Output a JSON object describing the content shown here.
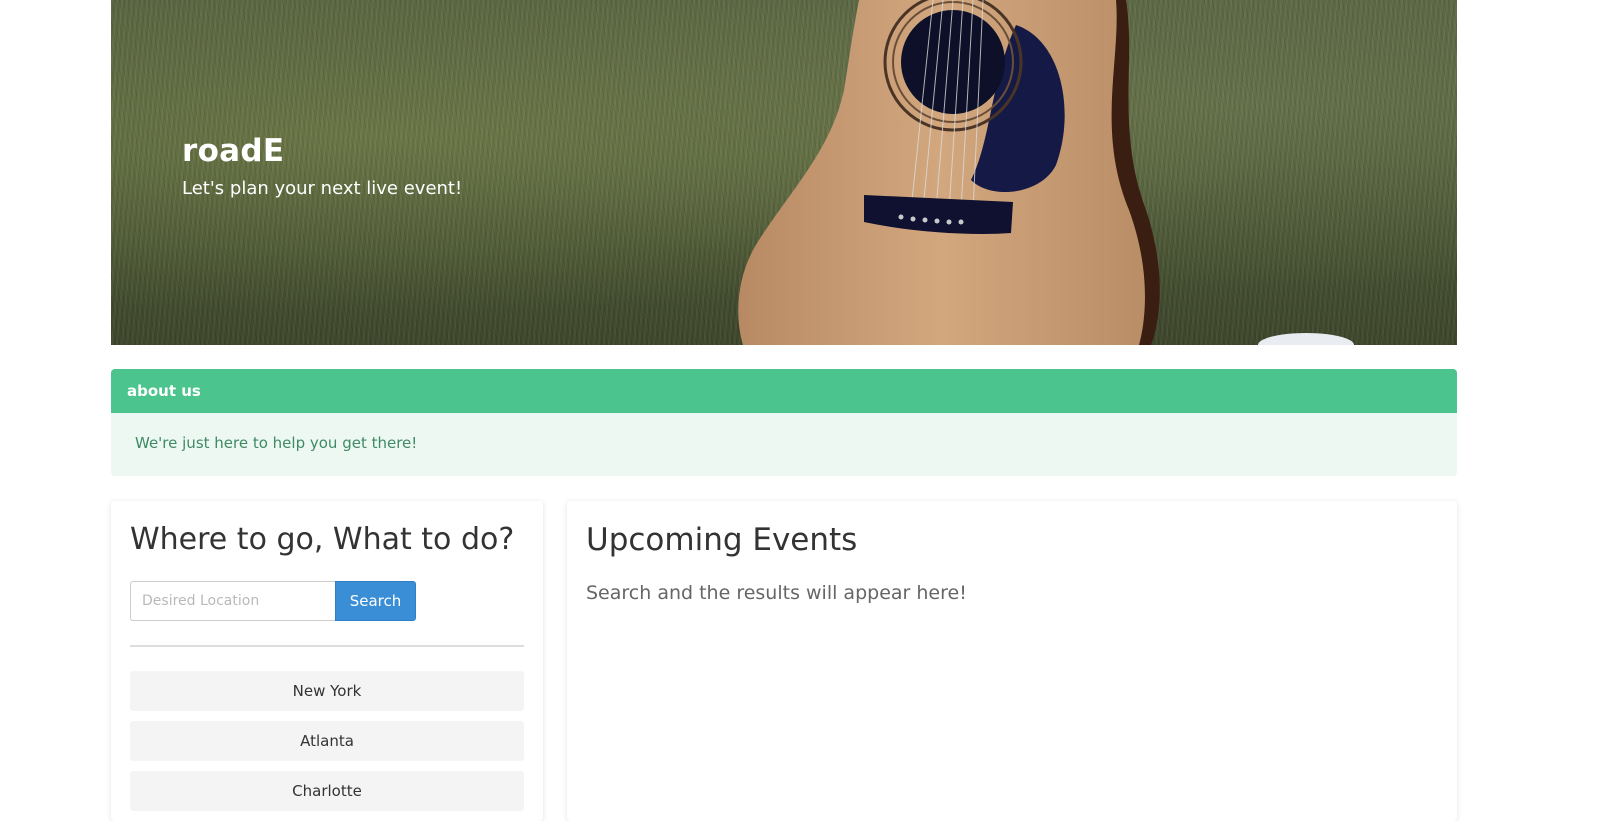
{
  "hero": {
    "title": "roadE",
    "subtitle": "Let's plan your next live event!"
  },
  "about": {
    "heading": "about us",
    "body": "We're just here to help you get there!"
  },
  "search_card": {
    "title": "Where to go, What to do?",
    "input_placeholder": "Desired Location",
    "input_value": "",
    "search_label": "Search",
    "cities": [
      "New York",
      "Atlanta",
      "Charlotte"
    ]
  },
  "events_card": {
    "title": "Upcoming Events",
    "empty_message": "Search and the results will appear here!"
  },
  "colors": {
    "about_header": "#4bc58d",
    "about_body_bg": "#edf8f2",
    "search_button": "#3a8ed6"
  }
}
